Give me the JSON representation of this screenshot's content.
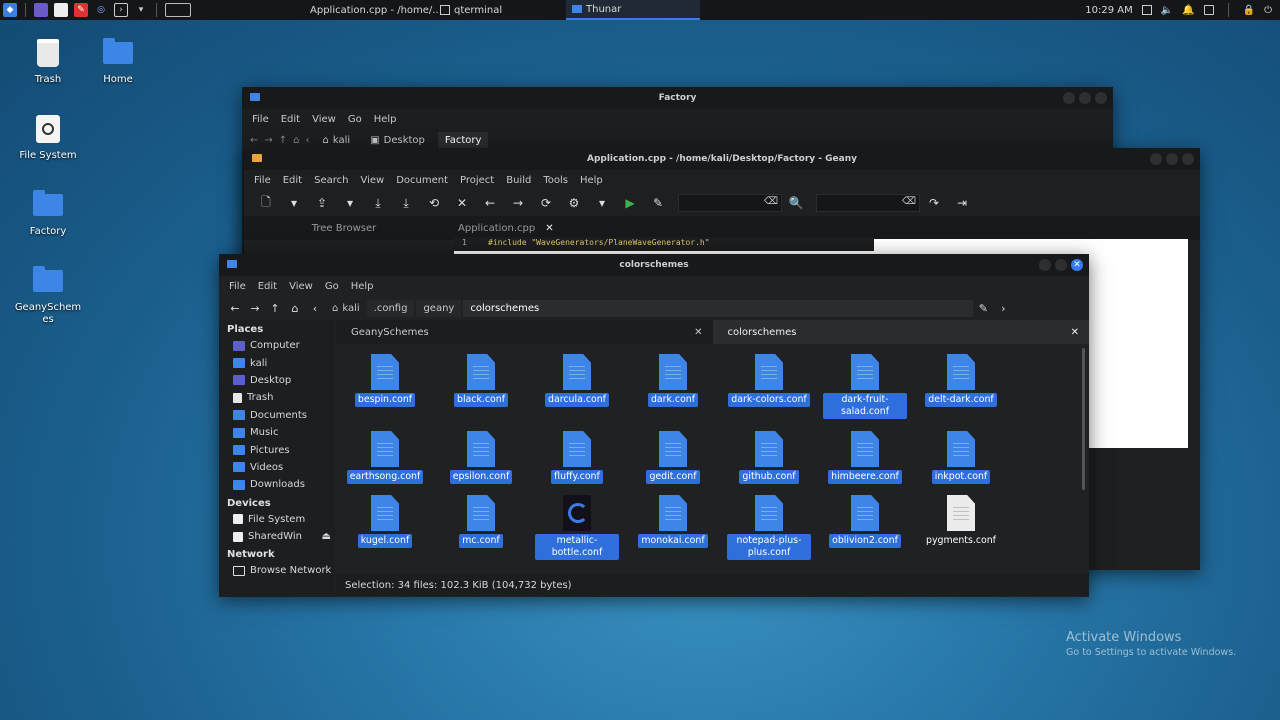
{
  "panel": {
    "tasks": [
      {
        "label": "Application.cpp - /home/...",
        "icon": "geany-icon"
      },
      {
        "label": "qterminal",
        "icon": "terminal-icon"
      },
      {
        "label": "Thunar",
        "icon": "folder-icon"
      }
    ],
    "clock": "10:29 AM"
  },
  "desktop": {
    "icons": [
      {
        "label": "Trash"
      },
      {
        "label": "Home"
      },
      {
        "label": "File System"
      },
      {
        "label": "Factory"
      },
      {
        "label": "GeanySchemes"
      }
    ]
  },
  "factory_window": {
    "title": "Factory",
    "menu": [
      "File",
      "Edit",
      "View",
      "Go",
      "Help"
    ],
    "path": [
      "kali",
      "Desktop",
      "Factory"
    ]
  },
  "geany_window": {
    "title": "Application.cpp - /home/kali/Desktop/Factory - Geany",
    "menu": [
      "File",
      "Edit",
      "Search",
      "View",
      "Document",
      "Project",
      "Build",
      "Tools",
      "Help"
    ],
    "sidebar_tab": "Tree Browser",
    "file_tab": "Application.cpp",
    "code_line_number": "1",
    "code_line": "#include \"WaveGenerators/PlaneWaveGenerator.h\""
  },
  "thunar": {
    "title": "colorschemes",
    "menu": [
      "File",
      "Edit",
      "View",
      "Go",
      "Help"
    ],
    "path": [
      "kali",
      ".config",
      "geany",
      "colorschemes"
    ],
    "sidebar": {
      "places_header": "Places",
      "places": [
        "Computer",
        "kali",
        "Desktop",
        "Trash",
        "Documents",
        "Music",
        "Pictures",
        "Videos",
        "Downloads"
      ],
      "devices_header": "Devices",
      "devices": [
        "File System",
        "SharedWin"
      ],
      "network_header": "Network",
      "network": [
        "Browse Network"
      ]
    },
    "tabs": [
      "GeanySchemes",
      "colorschemes"
    ],
    "files": [
      {
        "name": "bespin.conf",
        "selected": true
      },
      {
        "name": "black.conf",
        "selected": true
      },
      {
        "name": "darcula.conf",
        "selected": true
      },
      {
        "name": "dark.conf",
        "selected": true
      },
      {
        "name": "dark-colors.conf",
        "selected": true
      },
      {
        "name": "dark-fruit-salad.conf",
        "selected": true
      },
      {
        "name": "delt-dark.conf",
        "selected": true
      },
      {
        "name": "earthsong.conf",
        "selected": true
      },
      {
        "name": "epsilon.conf",
        "selected": true
      },
      {
        "name": "fluffy.conf",
        "selected": true
      },
      {
        "name": "gedit.conf",
        "selected": true
      },
      {
        "name": "github.conf",
        "selected": true
      },
      {
        "name": "himbeere.conf",
        "selected": true
      },
      {
        "name": "inkpot.conf",
        "selected": true
      },
      {
        "name": "kugel.conf",
        "selected": true
      },
      {
        "name": "mc.conf",
        "selected": true
      },
      {
        "name": "metallic-bottle.conf",
        "selected": true
      },
      {
        "name": "monokai.conf",
        "selected": true
      },
      {
        "name": "notepad-plus-plus.conf",
        "selected": true
      },
      {
        "name": "oblivion2.conf",
        "selected": true
      },
      {
        "name": "pygments.conf",
        "selected": false
      }
    ],
    "status": "Selection: 34 files: 102.3 KiB (104,732 bytes)"
  },
  "watermark": {
    "line1": "Activate Windows",
    "line2": "Go to Settings to activate Windows."
  },
  "colors": {
    "accent": "#367bf0",
    "selection": "#2f6fdb",
    "file_blue": "#3d86e8"
  }
}
